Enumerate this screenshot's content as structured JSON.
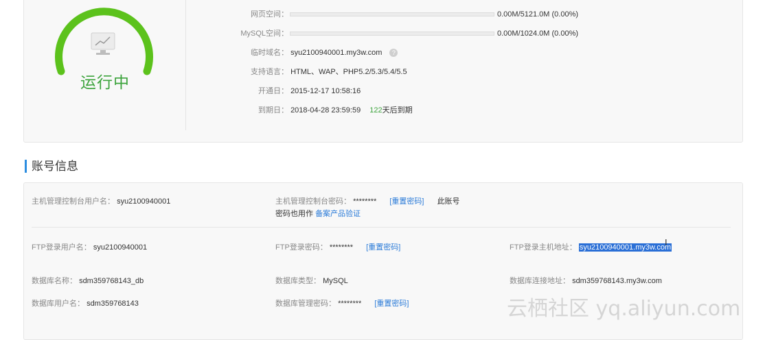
{
  "status": {
    "label": "运行中",
    "color": "#3ca33c"
  },
  "info": {
    "web_space": {
      "label": "网页空间：",
      "value": "0.00M/5121.0M (0.00%)",
      "used_fraction": 0.0
    },
    "mysql_space": {
      "label": "MySQL空间：",
      "value": "0.00M/1024.0M (0.00%)",
      "used_fraction": 0.0
    },
    "temp_domain": {
      "label": "临时域名：",
      "value": "syu2100940001.my3w.com",
      "help_icon": "?"
    },
    "languages": {
      "label": "支持语言：",
      "value": "HTML、WAP、PHP5.2/5.3/5.4/5.5"
    },
    "open_date": {
      "label": "开通日：",
      "value": "2015-12-17 10:58:16"
    },
    "expire_date": {
      "label": "到期日：",
      "value": "2018-04-28 23:59:59",
      "days": "122",
      "days_suffix": "天后到期"
    }
  },
  "account": {
    "title": "账号信息",
    "console_user": {
      "label": "主机管理控制台用户名：",
      "value": "syu2100940001"
    },
    "console_pwd": {
      "label": "主机管理控制台密码：",
      "value": "********",
      "reset": "[重置密码]",
      "note1": "此账号",
      "note2": "密码也用作",
      "note_link": "备案产品验证"
    },
    "ftp_user": {
      "label": "FTP登录用户名：",
      "value": "syu2100940001"
    },
    "ftp_pwd": {
      "label": "FTP登录密码：",
      "value": "********",
      "reset": "[重置密码]"
    },
    "ftp_host": {
      "label": "FTP登录主机地址：",
      "value": "syu2100940001.my3w.com"
    },
    "db_name": {
      "label": "数据库名称：",
      "value": "sdm359768143_db"
    },
    "db_type": {
      "label": "数据库类型：",
      "value": "MySQL"
    },
    "db_host": {
      "label": "数据库连接地址：",
      "value": "sdm359768143.my3w.com"
    },
    "db_user": {
      "label": "数据库用户名：",
      "value": "sdm359768143"
    },
    "db_pwd": {
      "label": "数据库管理密码：",
      "value": "********",
      "reset": "[重置密码]"
    }
  },
  "watermark": "云栖社区 yq.aliyun.com"
}
